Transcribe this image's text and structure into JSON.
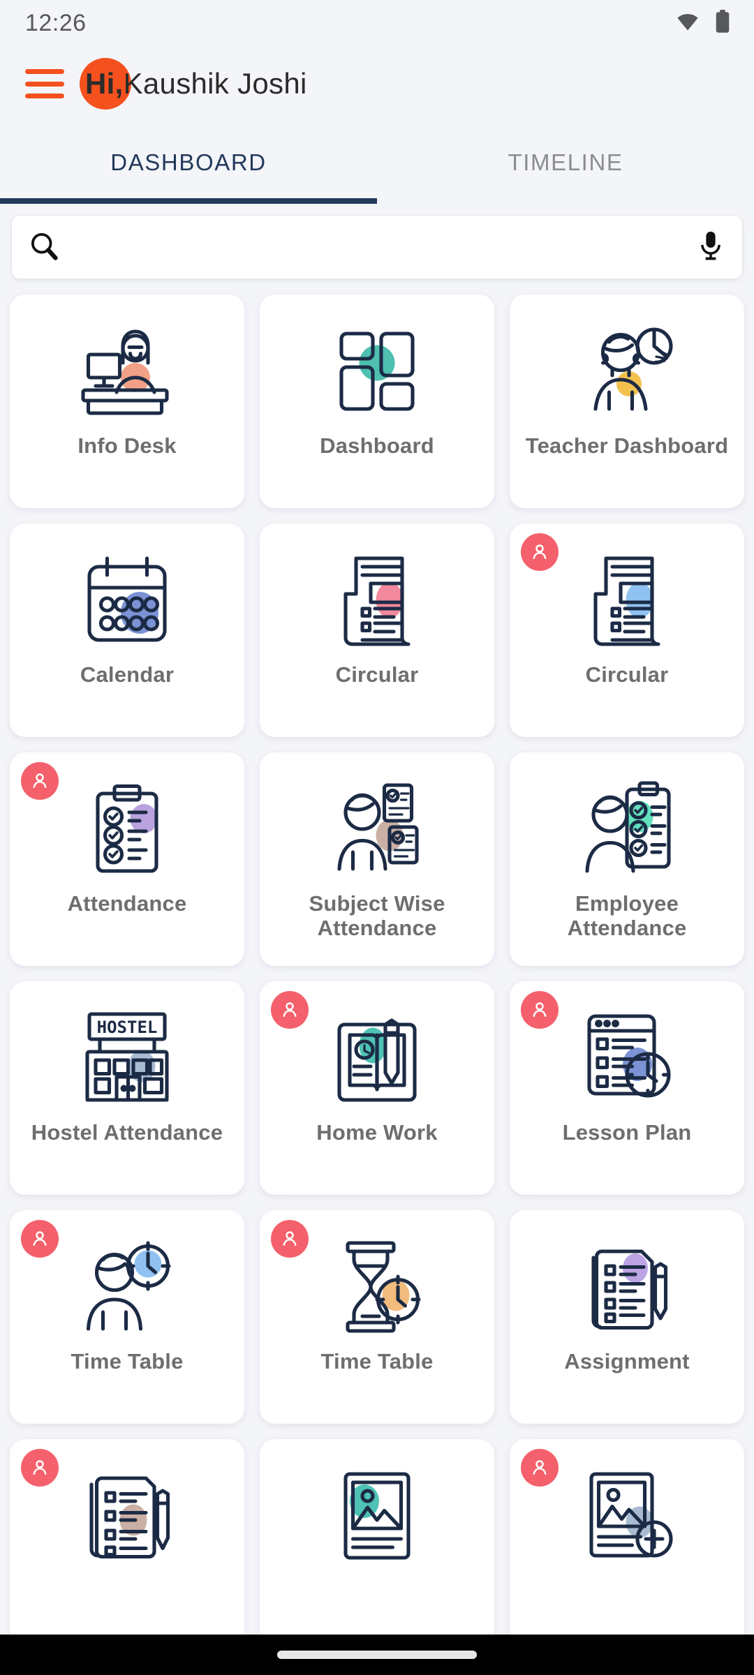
{
  "status_bar": {
    "time": "12:26",
    "icons": [
      "wifi-icon",
      "battery-icon"
    ]
  },
  "app_bar": {
    "menu_icon": "hamburger-menu-icon",
    "greeting_prefix": "Hi,",
    "user_name": "Kaushik  Joshi",
    "avatar_color": "#F4511E"
  },
  "tabs": {
    "items": [
      {
        "label": "DASHBOARD",
        "active": true
      },
      {
        "label": "TIMELINE",
        "active": false
      }
    ],
    "active_color": "#23395B",
    "inactive_color": "#8A8C92"
  },
  "search": {
    "value": "",
    "placeholder": "",
    "left_icon": "search-icon",
    "right_icon": "microphone-icon"
  },
  "grid": {
    "badge_color": "#F4606B",
    "items": [
      {
        "label": "Info Desk",
        "icon": "info-desk-icon",
        "badge": false,
        "accent": "#F2A086"
      },
      {
        "label": "Dashboard",
        "icon": "dashboard-grid-icon",
        "badge": false,
        "accent": "#4FBFB0"
      },
      {
        "label": "Teacher Dashboard",
        "icon": "teacher-dashboard-icon",
        "badge": false,
        "accent": "#F2C14E"
      },
      {
        "label": "Calendar",
        "icon": "calendar-icon",
        "badge": false,
        "accent": "#7B92D4"
      },
      {
        "label": "Circular",
        "icon": "circular-icon",
        "badge": false,
        "accent": "#F2889C"
      },
      {
        "label": "Circular",
        "icon": "circular-icon",
        "badge": true,
        "accent": "#8FC2F0"
      },
      {
        "label": "Attendance",
        "icon": "attendance-clipboard-icon",
        "badge": true,
        "accent": "#B9A2DE"
      },
      {
        "label": "Subject Wise Attendance",
        "icon": "subject-wise-attendance-icon",
        "badge": false,
        "accent": "#C9AFA4"
      },
      {
        "label": "Employee Attendance",
        "icon": "employee-attendance-icon",
        "badge": false,
        "accent": "#63E0BE"
      },
      {
        "label": "Hostel Attendance",
        "icon": "hostel-building-icon",
        "badge": false,
        "accent": "#A8BBD1"
      },
      {
        "label": "Home Work",
        "icon": "home-work-book-icon",
        "badge": true,
        "accent": "#4FC2B4"
      },
      {
        "label": "Lesson Plan",
        "icon": "lesson-plan-clock-icon",
        "badge": true,
        "accent": "#7B92D4"
      },
      {
        "label": "Time Table",
        "icon": "time-table-person-icon",
        "badge": true,
        "accent": "#8FC2F0"
      },
      {
        "label": "Time Table",
        "icon": "time-table-hourglass-icon",
        "badge": true,
        "accent": "#F2BC7E"
      },
      {
        "label": "Assignment",
        "icon": "assignment-pen-icon",
        "badge": false,
        "accent": "#BCA4E4"
      },
      {
        "label": "",
        "icon": "document-pen-icon",
        "badge": true,
        "accent": "#C9AFA4"
      },
      {
        "label": "",
        "icon": "gallery-icon",
        "badge": false,
        "accent": "#4FC2B4"
      },
      {
        "label": "",
        "icon": "gallery-add-icon",
        "badge": true,
        "accent": "#A8BBD1"
      }
    ]
  },
  "nav_bar": {
    "home_indicator": "home-indicator"
  },
  "theme": {
    "background": "#F4F5F9",
    "card_background": "#FFFFFF",
    "line_art": "#1C2B45",
    "label_color": "#6E6E6E"
  }
}
